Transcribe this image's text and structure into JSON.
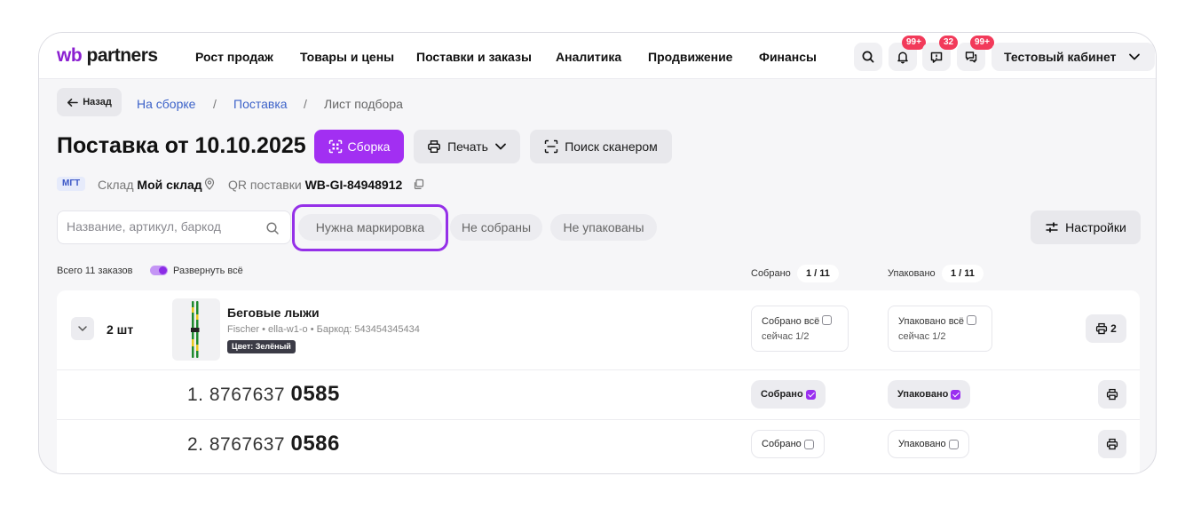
{
  "nav": {
    "logo_wb": "wb",
    "logo_partners": "partners",
    "items": [
      "Рост продаж",
      "Товары и цены",
      "Поставки и заказы",
      "Аналитика",
      "Продвижение",
      "Финансы"
    ],
    "badges": {
      "notifications": "99+",
      "reviews": "32",
      "chats": "99+"
    },
    "cabinet": "Тестовый кабинет"
  },
  "breadcrumb": {
    "back": "Назад",
    "items": [
      "На сборке",
      "Поставка",
      "Лист подбора"
    ],
    "separator": "/"
  },
  "header": {
    "title": "Поставка от 10.10.2025",
    "assembly_button": "Сборка",
    "print_button": "Печать",
    "scanner_button": "Поиск сканером"
  },
  "meta": {
    "tag": "МГТ",
    "warehouse_label": "Склад",
    "warehouse_value": "Мой склад",
    "qr_label": "QR поставки",
    "qr_value": "WB-GI-84948912"
  },
  "filters": {
    "search_placeholder": "Название, артикул, баркод",
    "chips": [
      "Нужна маркировка",
      "Не собраны",
      "Не упакованы"
    ],
    "settings_button": "Настройки"
  },
  "summary": {
    "total": "Всего 11 заказов",
    "expand_all": "Развернуть всё",
    "expand_all_on": true,
    "collected_label": "Собрано",
    "collected_count": "1 / 11",
    "packed_label": "Упаковано",
    "packed_count": "1 / 11"
  },
  "product": {
    "qty": "2 шт",
    "name": "Беговые лыжи",
    "details": "Fischer • ella-w1-o • Баркод: 543454345434",
    "color_tag": "Цвет: Зелёный",
    "collected_all": "Собрано всё",
    "collected_now": "сейчас 1/2",
    "packed_all": "Упаковано всё",
    "packed_now": "сейчас 1/2",
    "print_count": "2",
    "colors": {
      "accent": "#a22ff2",
      "ski": "#1f8a2e"
    }
  },
  "orders": [
    {
      "index": "1.",
      "prefix": "8767637",
      "suffix": "0585",
      "collected_label": "Собрано",
      "collected": true,
      "packed_label": "Упаковано",
      "packed": true
    },
    {
      "index": "2.",
      "prefix": "8767637",
      "suffix": "0586",
      "collected_label": "Собрано",
      "collected": false,
      "packed_label": "Упаковано",
      "packed": false
    }
  ]
}
